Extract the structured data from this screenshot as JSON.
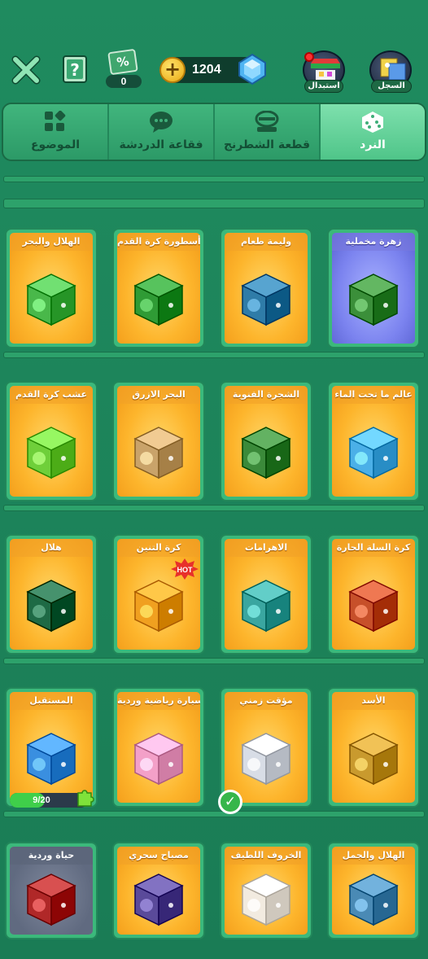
{
  "header": {
    "discount_count": "0",
    "discount_symbol": "%",
    "coins": "1204",
    "exchange_label": "استبدال",
    "history_label": "السجل"
  },
  "tabs": [
    {
      "label": "الموضوع",
      "icon": "grid-icon",
      "active": false
    },
    {
      "label": "فقاعة الدردشة",
      "icon": "chat-bubble-icon",
      "active": false
    },
    {
      "label": "قطعة الشطرنج",
      "icon": "chess-piece-icon",
      "active": false
    },
    {
      "label": "النرد",
      "icon": "dice-icon",
      "active": true
    }
  ],
  "colors": {
    "background": "#1f8b5f",
    "card_gold": "#fdb52c",
    "card_purple": "#7b83ef",
    "tab_active": "#7ee0ad"
  },
  "rows": [
    [
      {
        "title": "زهرة مخملية",
        "style": "purple",
        "dice_color": "#3b8f3a",
        "icon": "flower-dice-icon"
      },
      {
        "title": "وليمة طعام",
        "style": "gold",
        "dice_color": "#2f7ca8",
        "icon": "feast-dice-icon"
      },
      {
        "title": "أسطورة كرة القدم",
        "style": "gold",
        "dice_color": "#2f9b35",
        "icon": "football-legend-dice-icon"
      },
      {
        "title": "الهلال والبحر",
        "style": "gold",
        "dice_color": "#49b84a",
        "icon": "crescent-sea-dice-icon"
      }
    ],
    [
      {
        "title": "عالم ما تحت الماء",
        "style": "gold",
        "dice_color": "#4bb0e8",
        "icon": "underwater-dice-icon"
      },
      {
        "title": "الشجرة الفنوية",
        "style": "gold",
        "dice_color": "#3b8a3a",
        "icon": "tree-dice-icon"
      },
      {
        "title": "البحر الازرق",
        "style": "gold",
        "dice_color": "#c9a36a",
        "icon": "anchor-dice-icon"
      },
      {
        "title": "عشب كرة القدم",
        "style": "gold",
        "dice_color": "#6fcf3a",
        "icon": "soccer-ball-dice-icon"
      }
    ],
    [
      {
        "title": "كرة السلة الحارة",
        "style": "gold",
        "dice_color": "#c7502a",
        "icon": "basketball-dice-icon"
      },
      {
        "title": "الاهرامات",
        "style": "gold",
        "dice_color": "#3aa6a0",
        "icon": "pharaoh-dice-icon"
      },
      {
        "title": "كرة التنين",
        "style": "gold",
        "dice_color": "#f0a020",
        "icon": "dragon-dice-icon",
        "hot": "HOT"
      },
      {
        "title": "هلال",
        "style": "gold",
        "dice_color": "#1e6a45",
        "icon": "crescent-dice-icon"
      }
    ],
    [
      {
        "title": "الأسد",
        "style": "gold",
        "dice_color": "#c99a2e",
        "icon": "lion-dice-icon"
      },
      {
        "title": "مؤقت زمني",
        "style": "gold",
        "dice_color": "#d8dde6",
        "icon": "timer-dice-icon",
        "owned": true
      },
      {
        "title": "سيارة رياضية وردية",
        "style": "gold",
        "dice_color": "#f3a0c8",
        "icon": "pink-car-dice-icon"
      },
      {
        "title": "المستقبل",
        "style": "gold",
        "dice_color": "#3a8fe0",
        "icon": "future-dice-icon",
        "progress": "9/20",
        "progress_value": 0.45
      }
    ],
    [
      {
        "title": "الهلال والجمل",
        "style": "gold",
        "dice_color": "#4a8ab5",
        "icon": "camel-dice-icon"
      },
      {
        "title": "الخروف اللطيف",
        "style": "gold",
        "dice_color": "#f2ebe0",
        "icon": "sheep-dice-icon"
      },
      {
        "title": "مصباح سحري",
        "style": "gold",
        "dice_color": "#5a4a9a",
        "icon": "magic-lamp-dice-icon"
      },
      {
        "title": "حياة وردية",
        "style": "grey",
        "dice_color": "#b02828",
        "icon": "roses-dice-icon"
      }
    ]
  ]
}
